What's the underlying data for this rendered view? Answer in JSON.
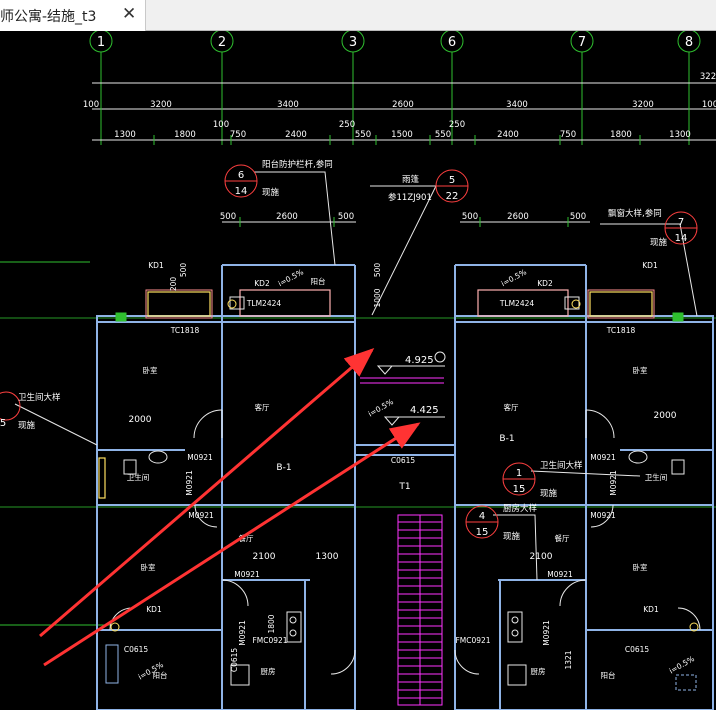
{
  "tab": {
    "title": "师公寓-结施_t3",
    "close_glyph": "✕"
  },
  "axis_labels": [
    "1",
    "2",
    "3",
    "6",
    "7",
    "8"
  ],
  "overall_dim": "322",
  "dims_row1": [
    "100",
    "3200",
    "3400",
    "2600",
    "3400",
    "3200",
    "100"
  ],
  "dims_row2": [
    "1300",
    "1800",
    "100",
    "750",
    "2400",
    "250",
    "550",
    "1500",
    "250",
    "550",
    "2400",
    "750",
    "1800",
    "1300"
  ],
  "dims_row3": [
    "500",
    "2600",
    "500",
    "500",
    "2600",
    "500"
  ],
  "callouts": [
    {
      "num": "6",
      "sheet": "14",
      "title": "阳台防护栏杆,参同",
      "note": "现施"
    },
    {
      "num": "5",
      "sheet": "22",
      "title": "雨篷",
      "note": "参11ZJ901"
    },
    {
      "num": "7",
      "sheet": "14",
      "title": "飘窗大样,参同",
      "note": "现施"
    },
    {
      "num": "5",
      "sheet": "",
      "title": "卫生间大样",
      "note": "现施"
    },
    {
      "num": "1",
      "sheet": "15",
      "title": "卫生间大样",
      "note": "现施"
    },
    {
      "num": "4",
      "sheet": "15",
      "title": "厨房大样",
      "note": "现施"
    }
  ],
  "levels": [
    "4.925",
    "4.425"
  ],
  "labels": {
    "kd1": "KD1",
    "kd2": "KD2",
    "tlm": "TLM2424",
    "tc": "TC1818",
    "bedroom": "卧室",
    "living": "客厅",
    "balcony": "阳台",
    "bath": "卫生间",
    "kitchen": "厨房",
    "dining": "餐厅",
    "b1": "B-1",
    "t1": "T1",
    "m0921": "M0921",
    "fmc": "FMC0921",
    "c0615": "C0615",
    "slope": "i=0.5%",
    "d2000": "2000",
    "d2100": "2100",
    "d1300": "1300",
    "d1800": "1800",
    "d1000": "1000",
    "d500": "500",
    "d200": "200",
    "d1321": "1321"
  },
  "colors": {
    "wall": "#8fb3e6",
    "dim": "#e8e8e8",
    "grid": "#2fbf2f",
    "annot": "#ff3333",
    "stair": "#ff35ff",
    "window": "#ffe060",
    "balcony": "#ff8f8f",
    "text": "#ffffff"
  }
}
